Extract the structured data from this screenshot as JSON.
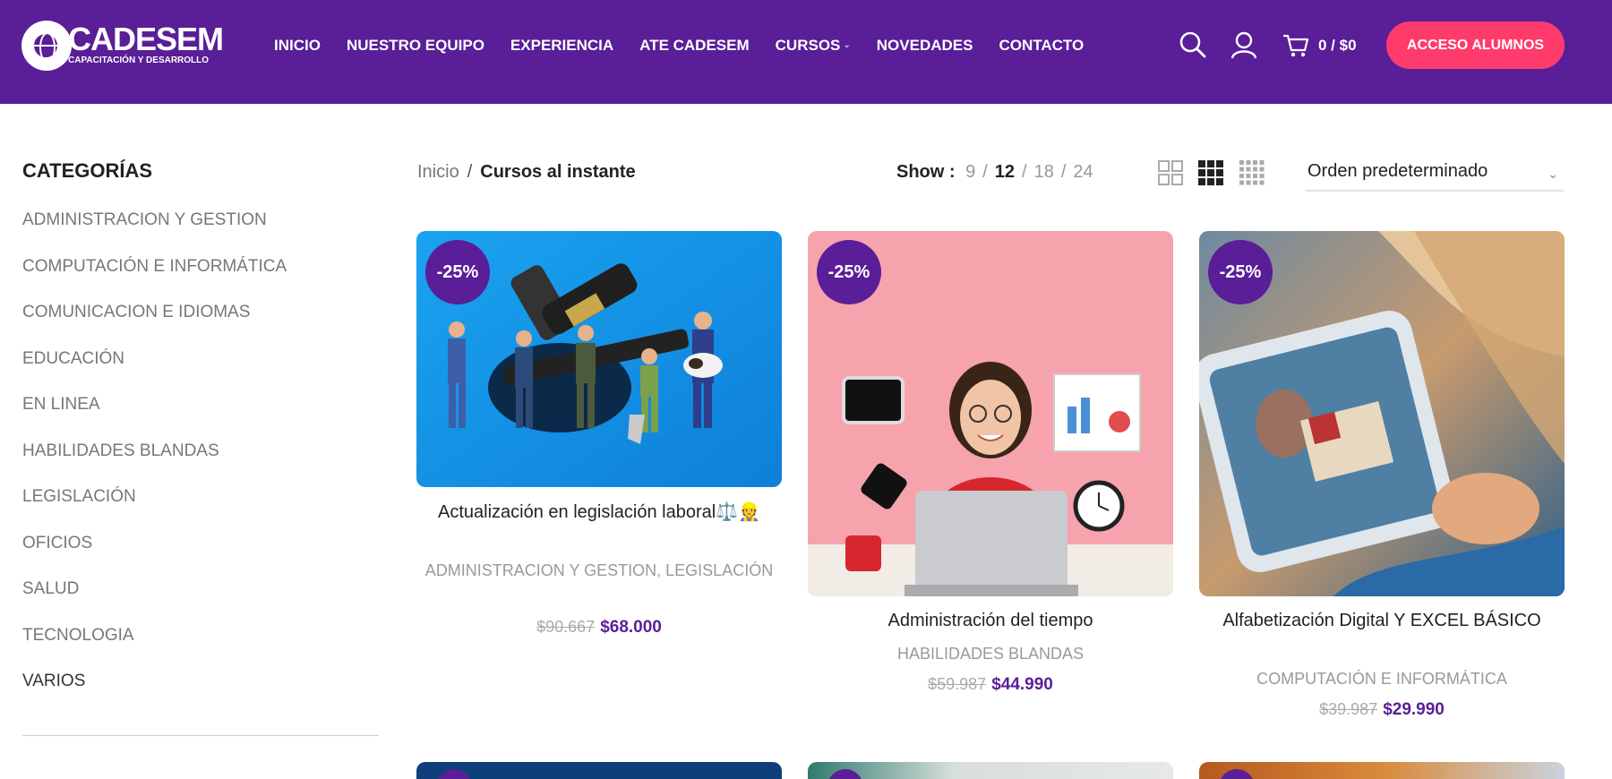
{
  "header": {
    "logo_name": "CADESEM",
    "logo_sub": "CAPACITACIÓN Y DESARROLLO",
    "nav": [
      "INICIO",
      "NUESTRO EQUIPO",
      "EXPERIENCIA",
      "ATE CADESEM",
      "CURSOS",
      "NOVEDADES",
      "CONTACTO"
    ],
    "cart_text": "0 / $0",
    "access_label": "ACCESO ALUMNOS",
    "icons": [
      "search-icon",
      "user-icon",
      "cart-icon"
    ]
  },
  "sidebar": {
    "title": "CATEGORÍAS",
    "items": [
      "ADMINISTRACION Y GESTION",
      "COMPUTACIÓN E INFORMÁTICA",
      "COMUNICACION E IDIOMAS",
      "EDUCACIÓN",
      "EN LINEA",
      "HABILIDADES BLANDAS",
      "LEGISLACIÓN",
      "OFICIOS",
      "SALUD",
      "TECNOLOGIA",
      "VARIOS"
    ]
  },
  "toolbar": {
    "breadcrumb_home": "Inicio",
    "breadcrumb_current": "Cursos al instante",
    "show_label": "Show :",
    "show_options": [
      "9",
      "12",
      "18",
      "24"
    ],
    "show_active": "12",
    "order_label": "Orden predeterminado"
  },
  "products": [
    {
      "badge": "-25%",
      "title": "Actualización en legislación laboral⚖️👷",
      "category": "ADMINISTRACION Y GESTION, LEGISLACIÓN",
      "old_price": "$90.667",
      "price": "$68.000"
    },
    {
      "badge": "-25%",
      "title": "Administración del tiempo",
      "category": "HABILIDADES BLANDAS",
      "old_price": "$59.987",
      "price": "$44.990"
    },
    {
      "badge": "-25%",
      "title": "Alfabetización Digital Y EXCEL BÁSICO",
      "category": "COMPUTACIÓN E INFORMÁTICA",
      "old_price": "$39.987",
      "price": "$29.990"
    }
  ],
  "colors": {
    "brand_purple": "#5a1e98",
    "accent_pink": "#ff3b6b"
  }
}
